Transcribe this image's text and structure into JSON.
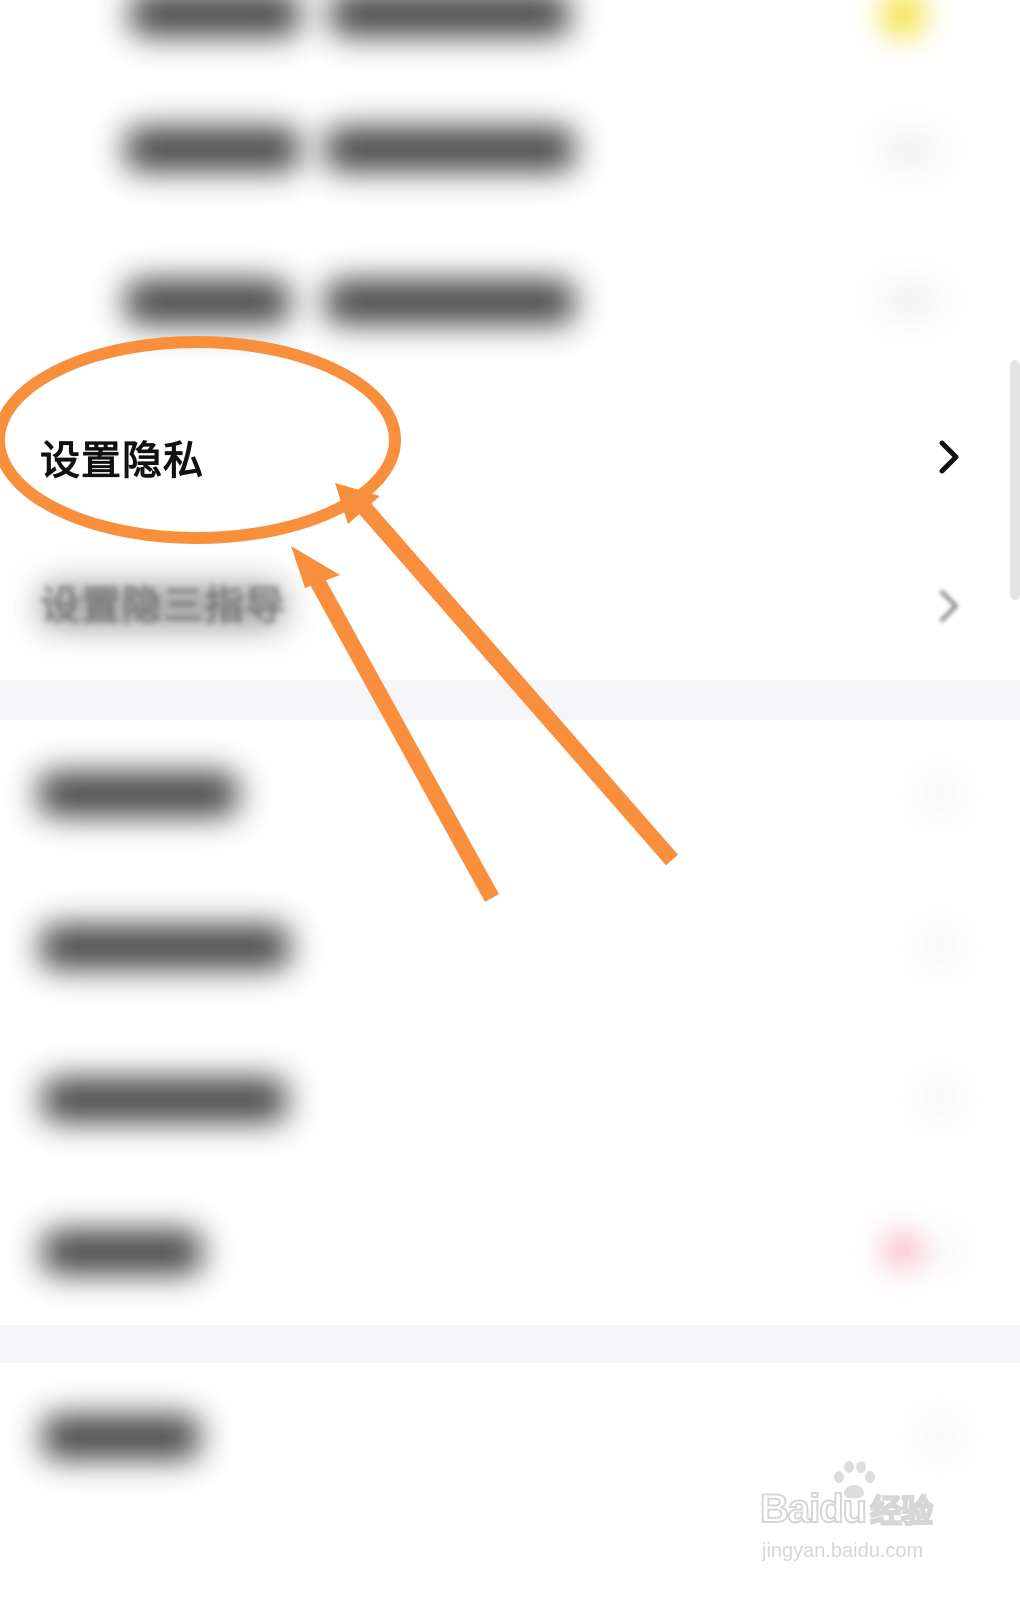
{
  "settings_list": {
    "highlighted_item": {
      "label": "设置隐私",
      "chevron_icon": "chevron-right-icon"
    },
    "partially_visible_item": {
      "label": "设置隐三指导"
    },
    "blurred_item_count_note": ""
  },
  "annotation": {
    "color": "#f98e3c",
    "shapes": [
      "ellipse-highlight",
      "arrow",
      "arrow"
    ]
  },
  "watermark": {
    "brand": "Bai",
    "brand_mid": "du",
    "suffix": "经验",
    "url": "jingyan.baidu.com",
    "icon": "paw-icon"
  },
  "colors": {
    "background": "#ffffff",
    "section_gap": "#f6f6f8",
    "text_primary": "#111111",
    "annotation_orange": "#f98e3c",
    "toggle_yellow": "#f3e24a",
    "badge_red": "#f28ba0"
  }
}
